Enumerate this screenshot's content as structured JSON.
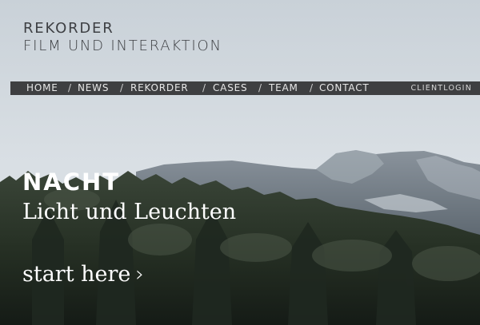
{
  "brand": {
    "line1": "REKORDER",
    "line2": "FILM UND INTERAKTION"
  },
  "nav": {
    "items": [
      "HOME",
      "NEWS",
      "REKORDER",
      "CASES",
      "TEAM",
      "CONTACT"
    ],
    "separator": "/",
    "client_login": "CLIENTLOGIN"
  },
  "hero": {
    "headline": "NACHT",
    "subline": "Licht und Leuchten",
    "cta": "start here",
    "cta_icon": "chevron-right-icon",
    "cta_glyph": "›"
  },
  "colors": {
    "nav_bar": "#3e3f41",
    "brand_text": "#3e4044",
    "hero_text": "#ffffff"
  }
}
